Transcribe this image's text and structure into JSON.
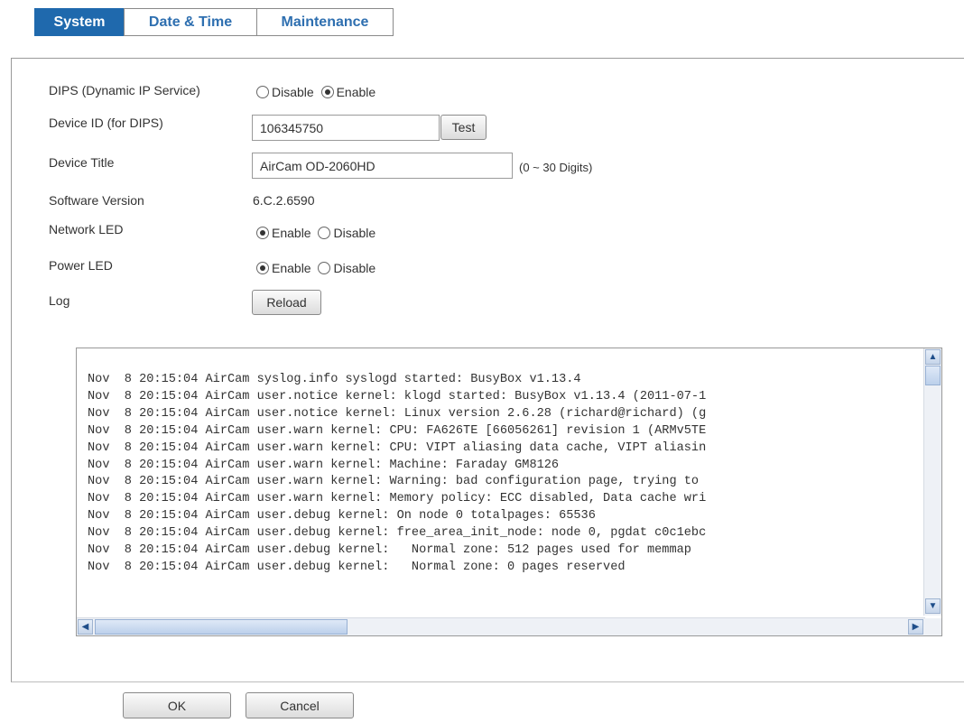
{
  "tabs": [
    {
      "label": "System",
      "active": true
    },
    {
      "label": "Date & Time",
      "active": false
    },
    {
      "label": "Maintenance",
      "active": false
    }
  ],
  "form": {
    "dips": {
      "label": "DIPS (Dynamic IP Service)",
      "opt_disable": "Disable",
      "opt_enable": "Enable",
      "selected": "Enable"
    },
    "device_id": {
      "label": "Device ID (for DIPS)",
      "value": "106345750",
      "test_button": "Test"
    },
    "device_title": {
      "label": "Device Title",
      "value": "AirCam OD-2060HD",
      "hint": "(0 ~ 30 Digits)"
    },
    "software_version": {
      "label": "Software Version",
      "value": "6.C.2.6590"
    },
    "network_led": {
      "label": "Network LED",
      "opt_enable": "Enable",
      "opt_disable": "Disable",
      "selected": "Enable"
    },
    "power_led": {
      "label": "Power LED",
      "opt_enable": "Enable",
      "opt_disable": "Disable",
      "selected": "Enable"
    },
    "log": {
      "label": "Log",
      "reload_button": "Reload"
    }
  },
  "log_lines": [
    "Nov  8 20:15:04 AirCam syslog.info syslogd started: BusyBox v1.13.4",
    "Nov  8 20:15:04 AirCam user.notice kernel: klogd started: BusyBox v1.13.4 (2011-07-1",
    "Nov  8 20:15:04 AirCam user.notice kernel: Linux version 2.6.28 (richard@richard) (g",
    "Nov  8 20:15:04 AirCam user.warn kernel: CPU: FA626TE [66056261] revision 1 (ARMv5TE",
    "Nov  8 20:15:04 AirCam user.warn kernel: CPU: VIPT aliasing data cache, VIPT aliasin",
    "Nov  8 20:15:04 AirCam user.warn kernel: Machine: Faraday GM8126",
    "Nov  8 20:15:04 AirCam user.warn kernel: Warning: bad configuration page, trying to",
    "Nov  8 20:15:04 AirCam user.warn kernel: Memory policy: ECC disabled, Data cache wri",
    "Nov  8 20:15:04 AirCam user.debug kernel: On node 0 totalpages: 65536",
    "Nov  8 20:15:04 AirCam user.debug kernel: free_area_init_node: node 0, pgdat c0c1ebc",
    "Nov  8 20:15:04 AirCam user.debug kernel:   Normal zone: 512 pages used for memmap",
    "Nov  8 20:15:04 AirCam user.debug kernel:   Normal zone: 0 pages reserved"
  ],
  "footer": {
    "ok": "OK",
    "cancel": "Cancel"
  },
  "colors": {
    "tab_active_bg": "#1f69ad",
    "tab_text": "#2e6fb0"
  },
  "icons": {
    "scroll_up": "scroll-up-arrow-icon",
    "scroll_down": "scroll-down-arrow-icon",
    "scroll_left": "scroll-left-arrow-icon",
    "scroll_right": "scroll-right-arrow-icon"
  }
}
